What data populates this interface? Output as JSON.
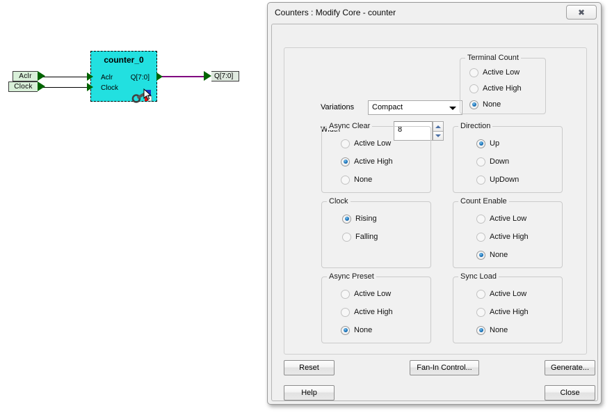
{
  "schematic": {
    "block": {
      "title": "counter_0",
      "inputs": [
        "Aclr",
        "Clock"
      ],
      "outputs": [
        "Q[7:0]"
      ],
      "fill_color": "#22e0e0",
      "icon": "wrench-cursor-icon"
    },
    "input_pins": [
      {
        "label": "Aclr"
      },
      {
        "label": "Clock"
      }
    ],
    "output_pins": [
      {
        "label": "Q[7:0]"
      }
    ],
    "wire_colors": {
      "signal": "#000000",
      "bus": "#800080"
    }
  },
  "dialog": {
    "title": "Counters : Modify Core - counter",
    "close_label": "✖",
    "variations": {
      "label": "Variations",
      "value": "Compact",
      "options": [
        "Compact"
      ]
    },
    "width": {
      "label": "Width",
      "value": "8"
    },
    "groups": [
      {
        "name": "terminal-count",
        "legend": "Terminal Count",
        "options": [
          {
            "label": "Active Low",
            "checked": false,
            "disabled": true
          },
          {
            "label": "Active High",
            "checked": false,
            "disabled": true
          },
          {
            "label": "None",
            "checked": true,
            "disabled": false
          }
        ]
      },
      {
        "name": "async-clear",
        "legend": "Async Clear",
        "options": [
          {
            "label": "Active Low",
            "checked": false,
            "disabled": true
          },
          {
            "label": "Active High",
            "checked": true,
            "disabled": false
          },
          {
            "label": "None",
            "checked": false,
            "disabled": true
          }
        ]
      },
      {
        "name": "direction",
        "legend": "Direction",
        "options": [
          {
            "label": "Up",
            "checked": true,
            "disabled": false
          },
          {
            "label": "Down",
            "checked": false,
            "disabled": true
          },
          {
            "label": "UpDown",
            "checked": false,
            "disabled": true
          }
        ]
      },
      {
        "name": "clock",
        "legend": "Clock",
        "options": [
          {
            "label": "Rising",
            "checked": true,
            "disabled": false
          },
          {
            "label": "Falling",
            "checked": false,
            "disabled": true
          }
        ]
      },
      {
        "name": "count-enable",
        "legend": "Count Enable",
        "options": [
          {
            "label": "Active Low",
            "checked": false,
            "disabled": true
          },
          {
            "label": "Active High",
            "checked": false,
            "disabled": true
          },
          {
            "label": "None",
            "checked": true,
            "disabled": false
          }
        ]
      },
      {
        "name": "async-preset",
        "legend": "Async Preset",
        "options": [
          {
            "label": "Active Low",
            "checked": false,
            "disabled": true
          },
          {
            "label": "Active High",
            "checked": false,
            "disabled": true
          },
          {
            "label": "None",
            "checked": true,
            "disabled": false
          }
        ]
      },
      {
        "name": "sync-load",
        "legend": "Sync Load",
        "options": [
          {
            "label": "Active Low",
            "checked": false,
            "disabled": true
          },
          {
            "label": "Active High",
            "checked": false,
            "disabled": true
          },
          {
            "label": "None",
            "checked": true,
            "disabled": false
          }
        ]
      }
    ],
    "buttons": {
      "reset": "Reset",
      "fan_in_control": "Fan-In Control...",
      "generate": "Generate...",
      "help": "Help",
      "close": "Close"
    }
  }
}
